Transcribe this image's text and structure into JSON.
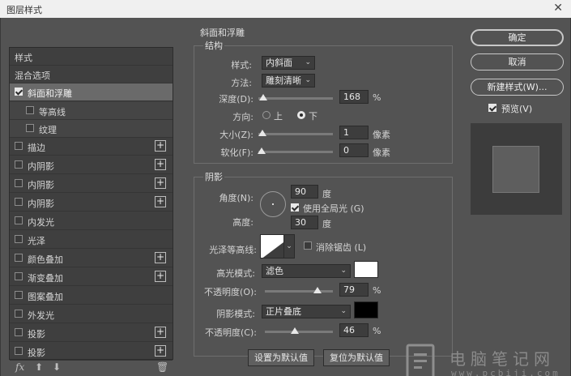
{
  "window": {
    "title": "图层样式",
    "close_glyph": "✕"
  },
  "left_list": {
    "header": "样式",
    "blend_options": "混合选项",
    "items": [
      {
        "label": "斜面和浮雕",
        "checked": true,
        "selected": true,
        "plus": false
      },
      {
        "label": "等高线",
        "checked": false,
        "sub": true,
        "plus": false
      },
      {
        "label": "纹理",
        "checked": false,
        "sub": true,
        "plus": false
      },
      {
        "label": "描边",
        "checked": false,
        "plus": true
      },
      {
        "label": "内阴影",
        "checked": false,
        "plus": true
      },
      {
        "label": "内阴影",
        "checked": false,
        "plus": true
      },
      {
        "label": "内阴影",
        "checked": false,
        "plus": true
      },
      {
        "label": "内发光",
        "checked": false,
        "plus": false
      },
      {
        "label": "光泽",
        "checked": false,
        "plus": false
      },
      {
        "label": "颜色叠加",
        "checked": false,
        "plus": true
      },
      {
        "label": "渐变叠加",
        "checked": false,
        "plus": true
      },
      {
        "label": "图案叠加",
        "checked": false,
        "plus": false
      },
      {
        "label": "外发光",
        "checked": false,
        "plus": false
      },
      {
        "label": "投影",
        "checked": false,
        "plus": true
      },
      {
        "label": "投影",
        "checked": false,
        "plus": true
      }
    ],
    "bottom_icons": {
      "fx": "fx",
      "up": "⬆",
      "down": "⬇",
      "trash": "🗑"
    }
  },
  "bevel": {
    "section_title": "斜面和浮雕",
    "structure": {
      "title": "结构",
      "style_label": "样式:",
      "style_value": "内斜面",
      "method_label": "方法:",
      "method_value": "雕刻清晰",
      "depth_label": "深度(D):",
      "depth_value": "168",
      "depth_unit": "%",
      "direction_label": "方向:",
      "dir_up": "上",
      "dir_down": "下",
      "size_label": "大小(Z):",
      "size_value": "1",
      "size_unit": "像素",
      "soften_label": "软化(F):",
      "soften_value": "0",
      "soften_unit": "像素"
    },
    "shading": {
      "title": "阴影",
      "angle_label": "角度(N):",
      "angle_value": "90",
      "angle_unit": "度",
      "global_light": "使用全局光 (G)",
      "altitude_label": "高度:",
      "altitude_value": "30",
      "altitude_unit": "度",
      "gloss_label": "光泽等高线:",
      "antialias": "消除锯齿 (L)",
      "highlight_label": "高光模式:",
      "highlight_mode": "滤色",
      "highlight_color": "#ffffff",
      "hl_opacity_label": "不透明度(O):",
      "hl_opacity_value": "79",
      "hl_opacity_unit": "%",
      "shadow_label": "阴影模式:",
      "shadow_mode": "正片叠底",
      "shadow_color": "#000000",
      "sh_opacity_label": "不透明度(C):",
      "sh_opacity_value": "46",
      "sh_opacity_unit": "%"
    },
    "make_default": "设置为默认值",
    "reset_default": "复位为默认值"
  },
  "right": {
    "ok": "确定",
    "cancel": "取消",
    "new_style": "新建样式(W)...",
    "preview_label": "预览(V)"
  },
  "watermark": {
    "text": "电脑笔记网",
    "url": "www.pcbiji.com"
  }
}
